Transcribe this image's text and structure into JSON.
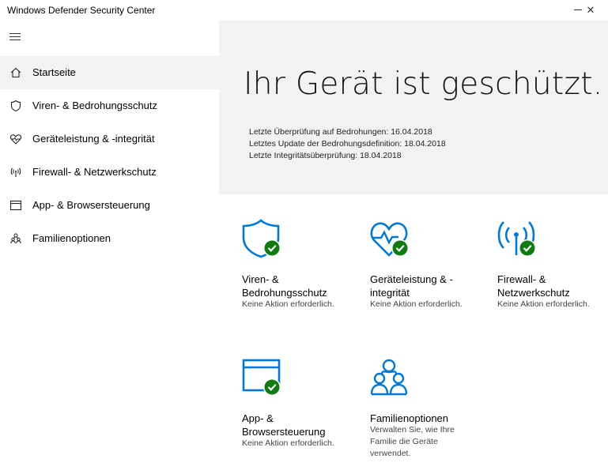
{
  "window": {
    "title": "Windows Defender Security Center",
    "minimize_icon": "minimize-icon",
    "close_label": "✕"
  },
  "sidebar": {
    "menu_icon": "hamburger-icon",
    "items": [
      {
        "label": "Startseite",
        "icon": "home-icon",
        "active": true
      },
      {
        "label": "Viren- & Bedrohungsschutz",
        "icon": "shield-icon",
        "active": false
      },
      {
        "label": "Geräteleistung & -integrität",
        "icon": "heart-icon",
        "active": false
      },
      {
        "label": "Firewall- & Netzwerkschutz",
        "icon": "antenna-icon",
        "active": false
      },
      {
        "label": "App- & Browsersteuerung",
        "icon": "browser-window-icon",
        "active": false
      },
      {
        "label": "Familienoptionen",
        "icon": "family-icon",
        "active": false
      }
    ]
  },
  "hero": {
    "title": "Ihr Gerät ist geschützt.",
    "info": [
      "Letzte Überprüfung auf Bedrohungen: 16.04.2018",
      "Letztes Update der Bedrohungsdefinition: 18.04.2018",
      "Letzte Integritätsüberprüfung: 18.04.2018"
    ]
  },
  "tiles": [
    {
      "title_line1": "Viren- &",
      "title_line2": "Bedrohungsschutz",
      "sub": "Keine Aktion erforderlich.",
      "icon": "shield-check-icon"
    },
    {
      "title_line1": "Geräteleistung & -",
      "title_line2": "integrität",
      "sub": "Keine Aktion erforderlich.",
      "icon": "heart-check-icon"
    },
    {
      "title_line1": "Firewall- &",
      "title_line2": "Netzwerkschutz",
      "sub": "Keine Aktion erforderlich.",
      "icon": "antenna-check-icon"
    },
    {
      "title_line1": "App- &",
      "title_line2": "Browsersteuerung",
      "sub": "Keine Aktion erforderlich.",
      "icon": "browser-check-icon"
    },
    {
      "title_line1": "Familienoptionen",
      "sub_lines": [
        "Verwalten Sie, wie Ihre",
        "Familie die Geräte",
        "verwendet."
      ],
      "icon": "family-icon"
    }
  ],
  "colors": {
    "accent": "#0078d7",
    "check": "#107c10",
    "hero_bg": "#f2f2f2",
    "active_nav_bg": "#f2f2f2"
  }
}
